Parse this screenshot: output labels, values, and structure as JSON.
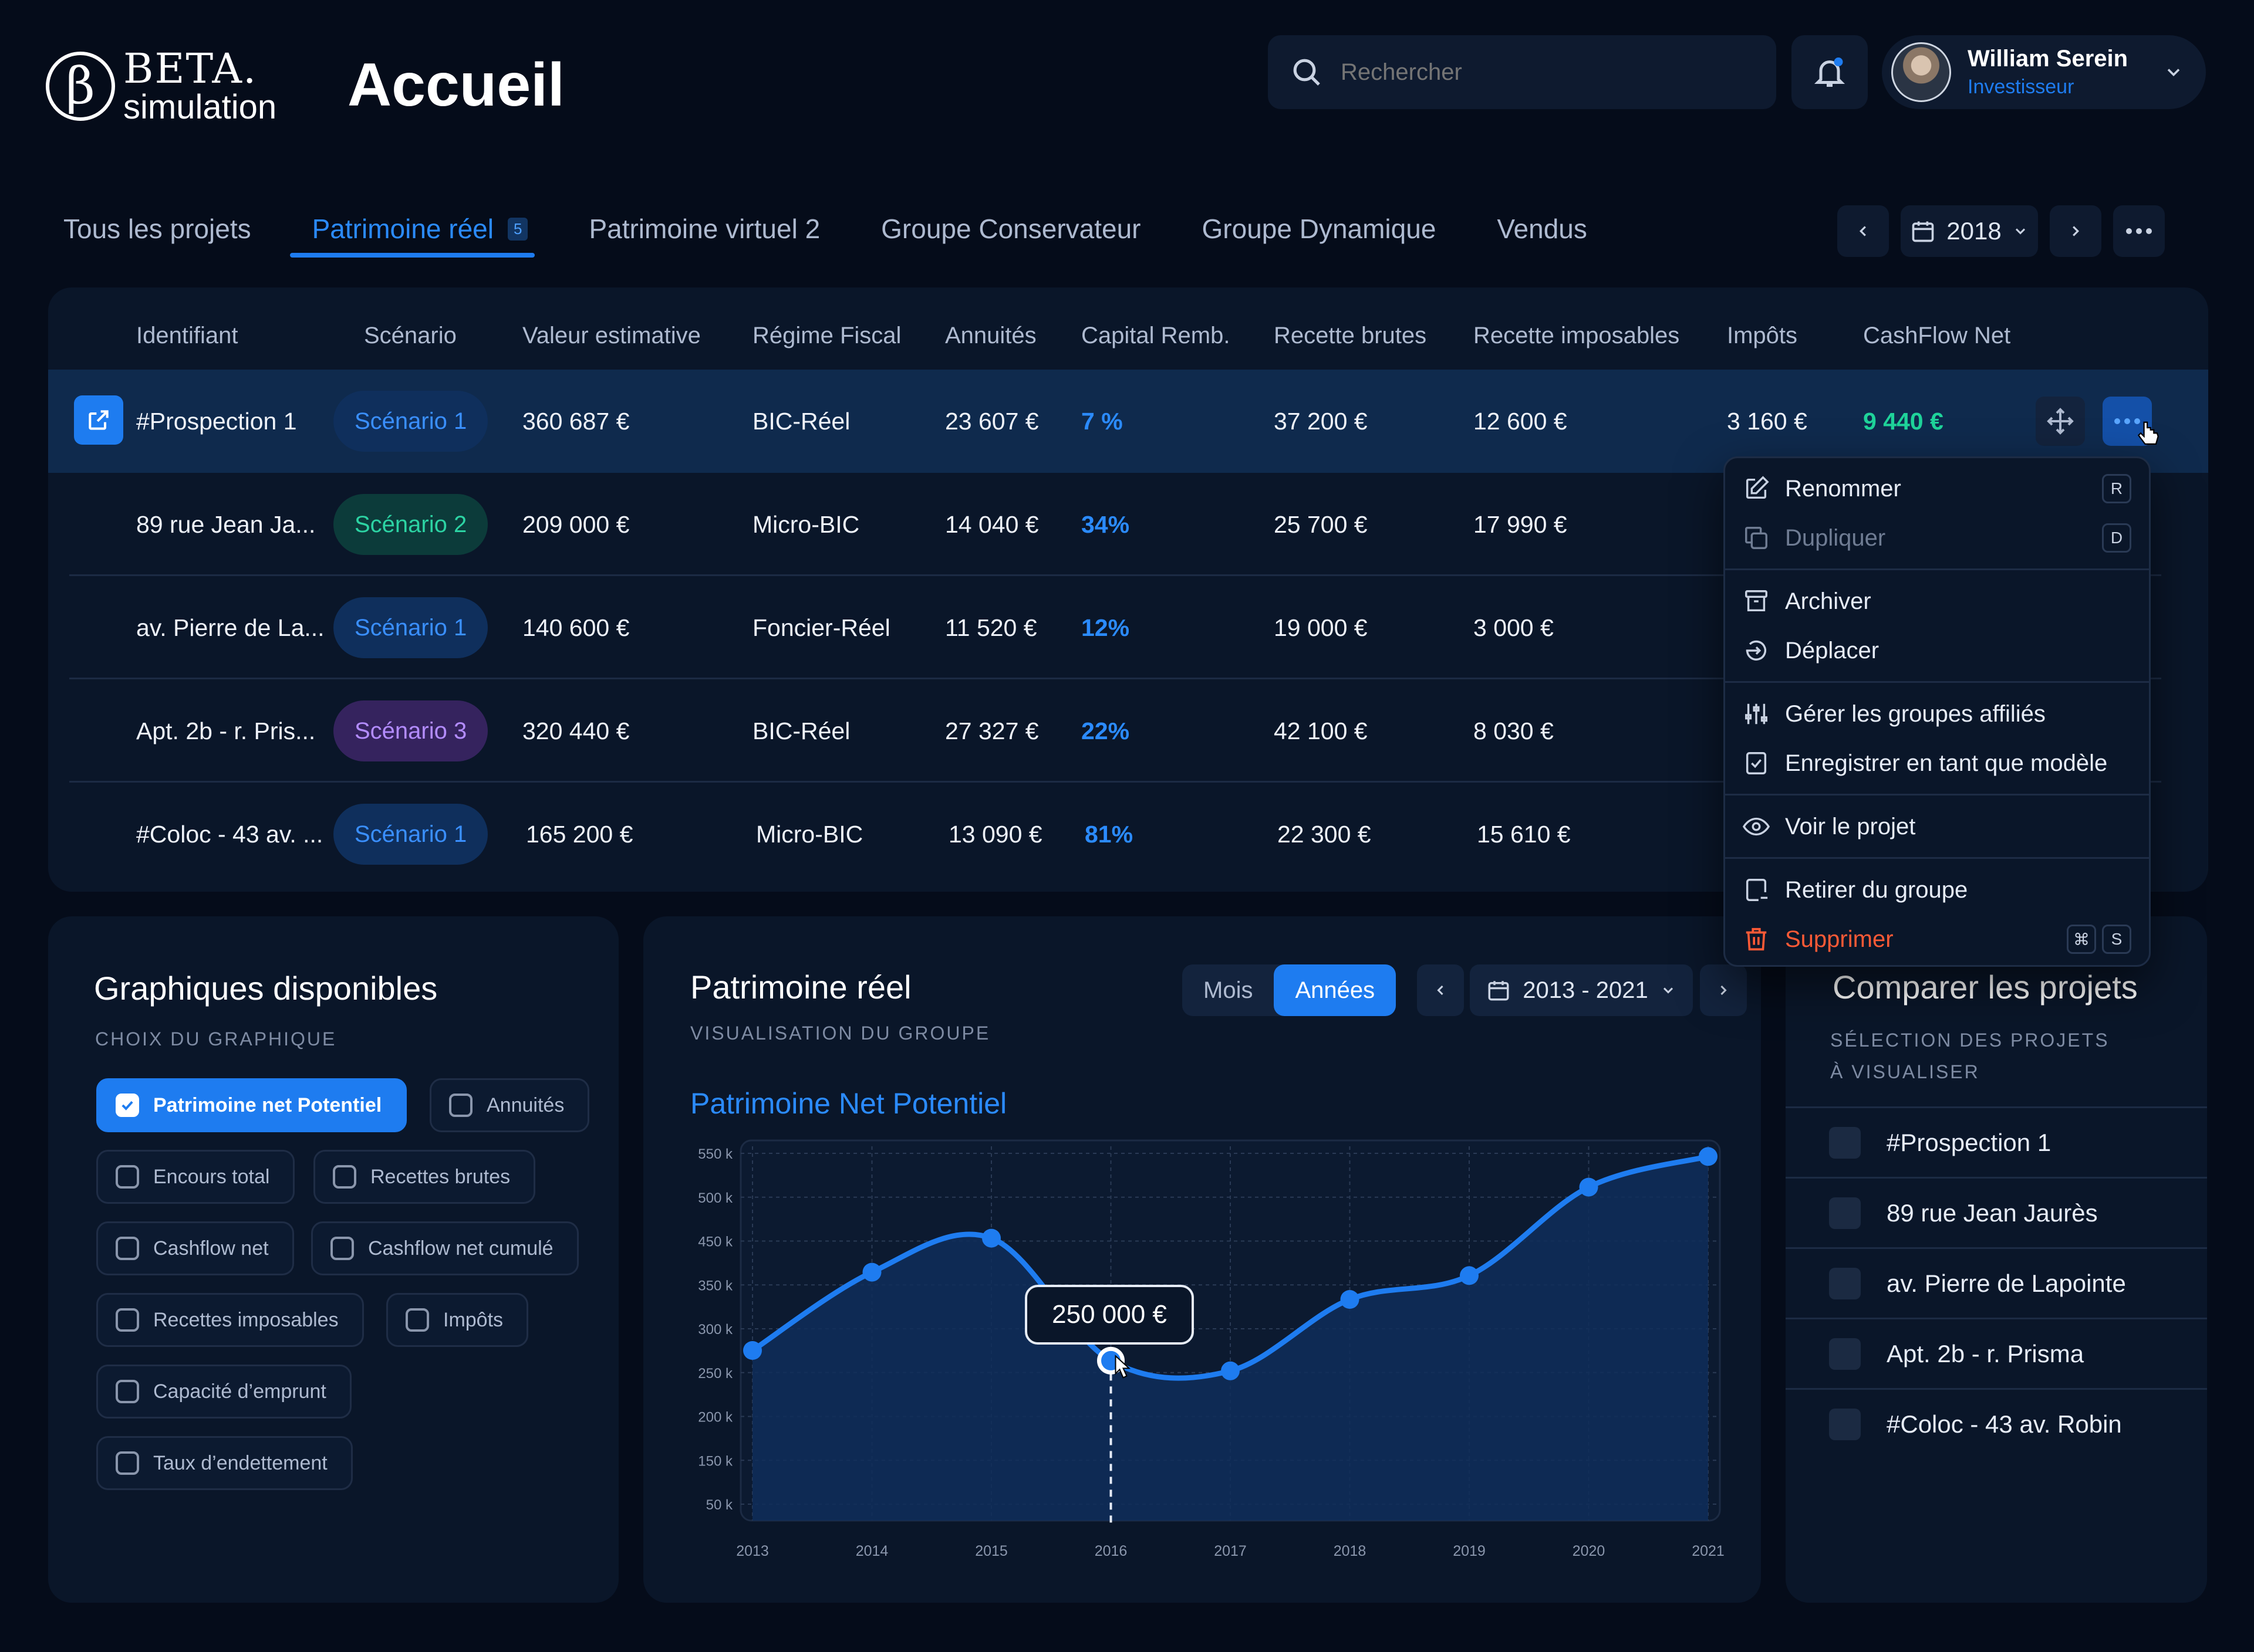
{
  "header": {
    "logo_top": "BETA.",
    "logo_bottom": "simulation",
    "title": "Accueil",
    "search_placeholder": "Rechercher",
    "user_name": "William Serein",
    "user_role": "Investisseur"
  },
  "tabs": [
    {
      "label": "Tous les projets"
    },
    {
      "label": "Patrimoine réel",
      "badge": "5",
      "active": true
    },
    {
      "label": "Patrimoine virtuel 2"
    },
    {
      "label": "Groupe Conservateur"
    },
    {
      "label": "Groupe Dynamique"
    },
    {
      "label": "Vendus"
    }
  ],
  "year": "2018",
  "table": {
    "headers": [
      "Identifiant",
      "Scénario",
      "Valeur estimative",
      "Régime Fiscal",
      "Annuités",
      "Capital Remb.",
      "Recette brutes",
      "Recette imposables",
      "Impôts",
      "CashFlow Net"
    ],
    "rows": [
      {
        "id": "#Prospection 1",
        "scenario": "Scénario 1",
        "valeur": "360 687 €",
        "regime": "BIC-Réel",
        "annuites": "23 607 €",
        "capital": "7 %",
        "brutes": "37 200 €",
        "imposables": "12 600 €",
        "impots": "3 160 €",
        "cashflow": "9 440 €"
      },
      {
        "id": "89 rue Jean Ja...",
        "scenario": "Scénario 2",
        "valeur": "209 000 €",
        "regime": "Micro-BIC",
        "annuites": "14 040 €",
        "capital": "34%",
        "brutes": "25 700 €",
        "imposables": "17 990 €"
      },
      {
        "id": "av. Pierre de La...",
        "scenario": "Scénario 1",
        "valeur": "140 600 €",
        "regime": "Foncier-Réel",
        "annuites": "11 520 €",
        "capital": "12%",
        "brutes": "19 000 €",
        "imposables": "3 000 €"
      },
      {
        "id": "Apt. 2b - r. Pris...",
        "scenario": "Scénario 3",
        "valeur": "320 440 €",
        "regime": "BIC-Réel",
        "annuites": "27 327 €",
        "capital": "22%",
        "brutes": "42 100 €",
        "imposables": "8 030 €"
      },
      {
        "id": "#Coloc - 43 av. ...",
        "scenario": "Scénario 1",
        "valeur": "165 200 €",
        "regime": "Micro-BIC",
        "annuites": "13 090 €",
        "capital": "81%",
        "brutes": "22 300 €",
        "imposables": "15 610 €"
      }
    ]
  },
  "menu": {
    "rename": "Renommer",
    "rename_key": "R",
    "duplicate": "Dupliquer",
    "duplicate_key": "D",
    "archive": "Archiver",
    "move": "Déplacer",
    "groups": "Gérer les groupes affiliés",
    "template": "Enregistrer en tant que modèle",
    "view": "Voir le projet",
    "remove": "Retirer du groupe",
    "delete": "Supprimer",
    "delete_key1": "⌘",
    "delete_key2": "S"
  },
  "graphs": {
    "title": "Graphiques disponibles",
    "subtitle": "CHOIX DU GRAPHIQUE",
    "chips": [
      "Patrimoine net Potentiel",
      "Annuités",
      "Encours total",
      "Recettes brutes",
      "Cashflow net",
      "Cashflow net cumulé",
      "Recettes imposables",
      "Impôts",
      "Capacité d’emprunt",
      "Taux d’endettement"
    ]
  },
  "chart_panel": {
    "title": "Patrimoine réel",
    "subtitle": "VISUALISATION DU GROUPE",
    "seg_month": "Mois",
    "seg_year": "Années",
    "range": "2013 - 2021",
    "tooltip": "250 000 €"
  },
  "chart_data": {
    "type": "area",
    "title": "Patrimoine Net Potentiel",
    "x": [
      "2013",
      "2014",
      "2015",
      "2016",
      "2017",
      "2018",
      "2019",
      "2020",
      "2021"
    ],
    "y_ticks": [
      "550 k",
      "500 k",
      "450 k",
      "350 k",
      "300 k",
      "250 k",
      "200 k",
      "150 k",
      "50 k"
    ],
    "series": [
      {
        "values": [
          250000,
          365000,
          415000,
          235000,
          220000,
          325000,
          360000,
          490000,
          535000
        ]
      }
    ],
    "ylim": [
      0,
      550000
    ],
    "highlight_index": 3,
    "grid": true,
    "color": "#1e7cf0"
  },
  "compare": {
    "title": "Comparer les projets",
    "subtitle1": "SÉLECTION DES PROJETS",
    "subtitle2": "À VISUALISER",
    "items": [
      "#Prospection 1",
      "89 rue Jean Jaurès",
      "av. Pierre de Lapointe",
      "Apt. 2b - r. Prisma",
      "#Coloc - 43 av. Robin"
    ]
  }
}
